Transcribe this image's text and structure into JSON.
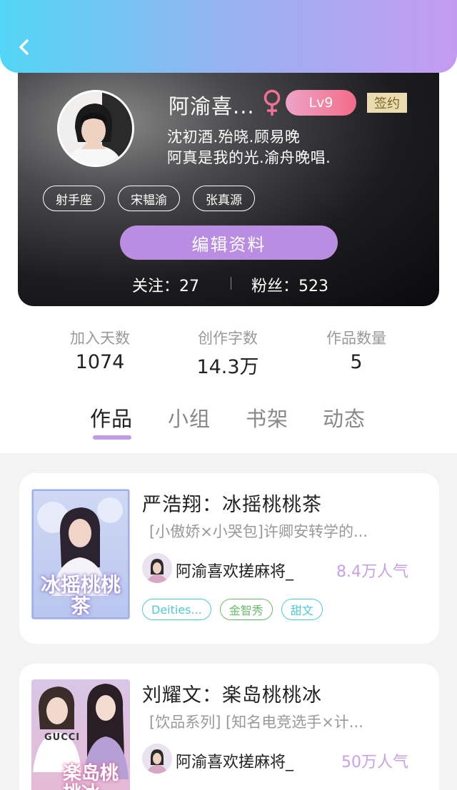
{
  "header": {
    "back_icon": "chevron-left-icon"
  },
  "profile": {
    "username": "阿渝喜...",
    "gender_icon": "female-icon",
    "level": "Lv9",
    "contract_badge": "签约",
    "bio_lines": [
      "沈初酒.殆晓.顾易晚",
      "阿真是我的光.渝舟晚唱."
    ],
    "tags": [
      "射手座",
      "宋韫渝",
      "张真源"
    ],
    "edit_button": "编辑资料",
    "following": "关注：27",
    "followers": "粉丝：523"
  },
  "stats": [
    {
      "label": "加入天数",
      "value": "1074"
    },
    {
      "label": "创作字数",
      "value": "14.3万"
    },
    {
      "label": "作品数量",
      "value": "5"
    }
  ],
  "tabs": [
    {
      "label": "作品",
      "active": true
    },
    {
      "label": "小组",
      "active": false
    },
    {
      "label": "书架",
      "active": false
    },
    {
      "label": "动态",
      "active": false
    }
  ],
  "works": [
    {
      "title": "严浩翔：冰摇桃桃茶",
      "description": "[小傲娇×小哭包]许卿安转学的...",
      "author": "阿渝喜欢搓麻将_",
      "popularity": "8.4万人气",
      "cover_text": "冰摇桃桃茶",
      "tags": [
        {
          "label": "Deities...",
          "color": "#4fc8d8"
        },
        {
          "label": "金智秀",
          "color": "#6cbb6c"
        },
        {
          "label": "甜文",
          "color": "#4fc8d8"
        }
      ]
    },
    {
      "title": "刘耀文：楽岛桃桃冰",
      "description": "[饮品系列] [知名电竞选手×计...",
      "author": "阿渝喜欢搓麻将_",
      "popularity": "50万人气",
      "cover_text": "楽岛桃桃冰",
      "cover_brand": "GUCCI",
      "tags": []
    }
  ],
  "colors": {
    "accent": "#b98ee2",
    "header_start": "#52d6f7",
    "header_end": "#c59af0"
  }
}
